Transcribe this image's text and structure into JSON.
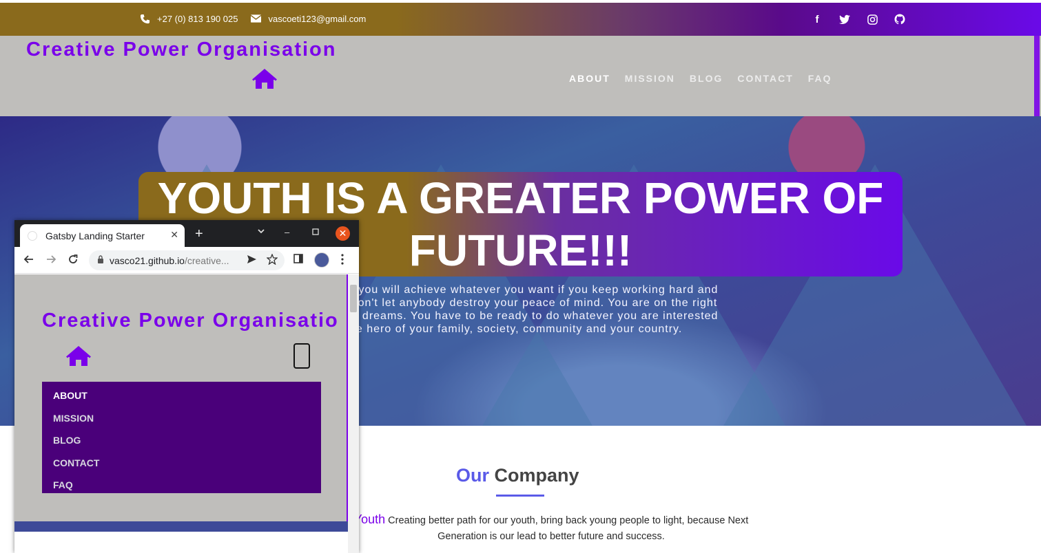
{
  "topbar": {
    "phone": "+27 (0) 813 190 025",
    "email": "vascoeti123@gmail.com",
    "social": [
      "facebook-icon",
      "twitter-icon",
      "instagram-icon",
      "github-icon"
    ]
  },
  "header": {
    "brand": "Creative Power Organisation",
    "nav": [
      "ABOUT",
      "MISSION",
      "BLOG",
      "CONTACT",
      "FAQ"
    ]
  },
  "hero": {
    "title_line1": "YOUTH IS A GREATER POWER OF",
    "title_line2": "FUTURE!!!",
    "text_lines": [
      "e and you will achieve whatever you want if you keep working hard and",
      "ore. Don't let anybody destroy your peace of mind. You are on the right",
      "e your dreams. You have to be ready to do whatever you are interested",
      "are the hero of your family, society, community and your country."
    ]
  },
  "company": {
    "heading_our": "Our",
    "heading_rest": "Company",
    "youth": "Youth",
    "text_1": "Creating better path for our youth, bring back young people to light, because Next",
    "text_2": "Generation is our lead to better future and success."
  },
  "browser": {
    "tab_title": "Gatsby Landing Starter",
    "url_host": "vasco21.github.io",
    "url_path": "/creative...",
    "brand": "Creative Power Organisatio",
    "menu": [
      "ABOUT",
      "MISSION",
      "BLOG",
      "CONTACT",
      "FAQ"
    ]
  },
  "colors": {
    "accent": "#7a00ea",
    "gold": "#8a6a1c",
    "menu_bg": "#4a007a",
    "header_bg": "#bfbebb"
  }
}
